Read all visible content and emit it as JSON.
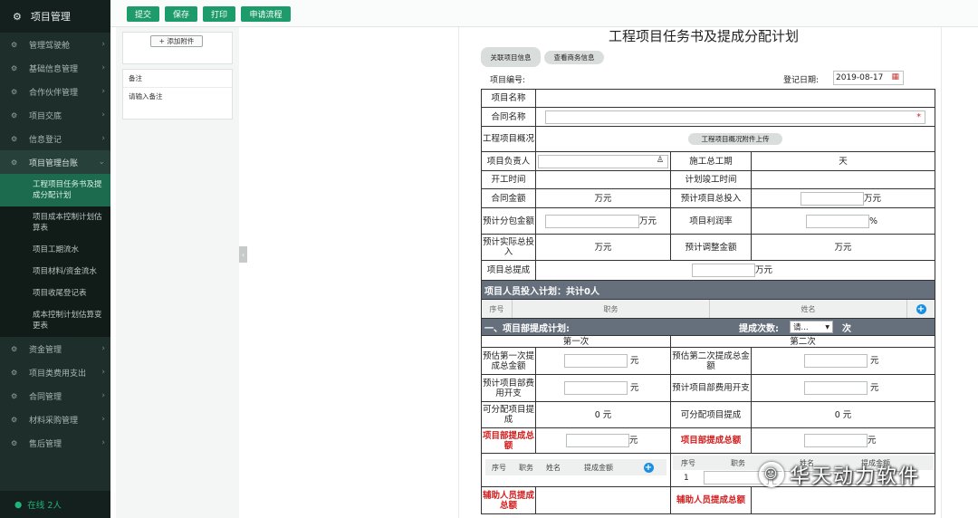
{
  "sidebar": {
    "top": "项目管理",
    "items": [
      "管理驾驶舱",
      "基础信息管理",
      "合作伙伴管理",
      "项目交底",
      "信息登记",
      "项目管理台账"
    ],
    "subitems": [
      "工程项目任务书及提成分配计划",
      "项目成本控制计划估算表",
      "项目工期流水",
      "项目材料/资金流水",
      "项目收尾登记表",
      "成本控制计划估算变更表"
    ],
    "items2": [
      "资金管理",
      "项目类费用支出",
      "合同管理",
      "材料采购管理",
      "售后管理"
    ],
    "online": "在线 2人"
  },
  "toolbar": {
    "submit": "提交",
    "save": "保存",
    "print": "打印",
    "flow": "申请流程"
  },
  "left": {
    "add_attach": "+ 添加附件",
    "note_title": "备注",
    "note_placeholder": "请输入备注"
  },
  "form": {
    "title": "工程项目任务书及提成分配计划",
    "related_btn": "关联项目信息",
    "business_btn": "查看商务信息",
    "project_no_label": "项目编号:",
    "reg_date_label": "登记日期:",
    "reg_date": "2019-08-17",
    "project_name": "项目名称",
    "contract_name": "合同名称",
    "required_mark": "*",
    "overview": "工程项目概况",
    "overview_btn": "工程项目概况附件上传",
    "manager": "项目负责人",
    "total_period": "施工总工期",
    "day_unit": "天",
    "start_time": "开工时间",
    "plan_end": "计划竣工时间",
    "contract_amount": "合同金额",
    "wan": "万元",
    "est_total_invest": "预计项目总投入",
    "est_sub_amount": "预计分包金额",
    "profit_rate": "项目利润率",
    "percent": "%",
    "est_actual_invest": "预计实际总投入",
    "est_adjust": "预计调整金额",
    "total_commission": "项目总提成",
    "staff_bar": "项目人员投入计划：共计0人",
    "staff_cols": [
      "序号",
      "职务",
      "姓名"
    ],
    "dept_bar": "一、项目部提成计划:",
    "times_label": "提成次数:",
    "times_select": "请...",
    "times_unit": "次",
    "first": "第一次",
    "second": "第二次",
    "est_first": "预估第一次提成总金额",
    "est_second": "预估第二次提成总金额",
    "yuan": "元",
    "dept_cost": "预计项目部费用开支",
    "dist_commission": "可分配项目提成",
    "zero_yuan": "0 元",
    "dept_total": "项目部提成总额",
    "sub_cols": [
      "序号",
      "职务",
      "姓名",
      "提成金额"
    ],
    "sub_cols2": [
      "序号",
      "职务",
      "姓名",
      "提成金额"
    ],
    "row_one": "1",
    "assist_total": "辅助人员提成总额"
  },
  "watermark": "华天动力软件"
}
